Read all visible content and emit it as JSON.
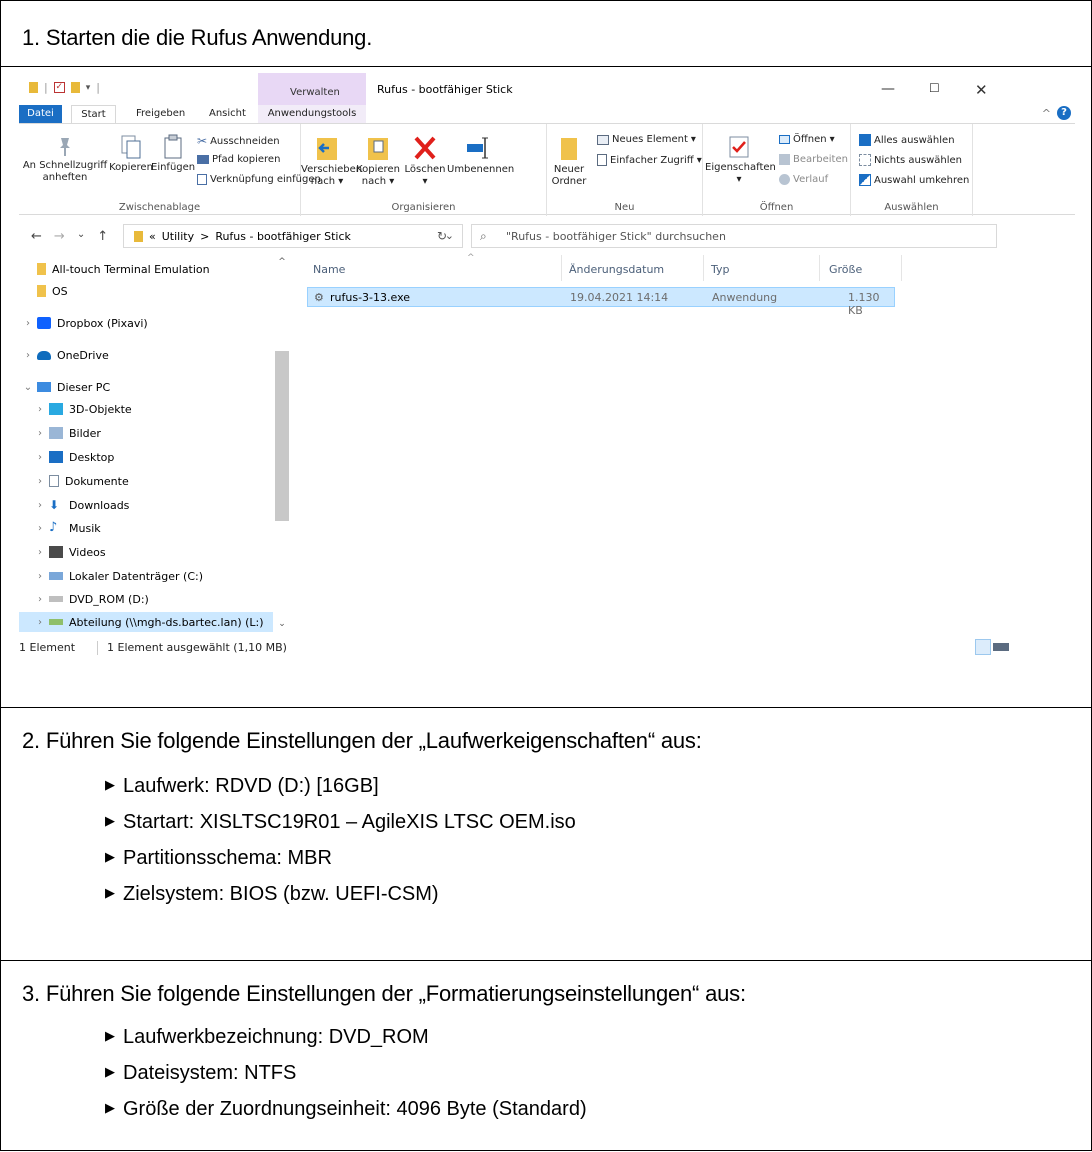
{
  "step1": {
    "title": "1. Starten die die Rufus Anwendung."
  },
  "explorer": {
    "window_title": "Rufus - bootfähiger Stick",
    "verwalten_tab": "Verwalten",
    "tabs": [
      "Datei",
      "Start",
      "Freigeben",
      "Ansicht",
      "Anwendungstools"
    ],
    "ribbon": {
      "zwischenablage": {
        "label": "Zwischenablage",
        "pin_line1": "An Schnellzugriff",
        "pin_line2": "anheften",
        "copy": "Kopieren",
        "paste": "Einfügen",
        "cut": "Ausschneiden",
        "copy_path": "Pfad kopieren",
        "paste_shortcut": "Verknüpfung einfügen"
      },
      "organisieren": {
        "label": "Organisieren",
        "move_line1": "Verschieben",
        "move_line2": "nach",
        "copyto_line1": "Kopieren",
        "copyto_line2": "nach",
        "delete": "Löschen",
        "rename": "Umbenennen"
      },
      "neu": {
        "label": "Neu",
        "new_folder_line1": "Neuer",
        "new_folder_line2": "Ordner",
        "new_item": "Neues Element",
        "easy_access": "Einfacher Zugriff"
      },
      "oeffnen": {
        "label": "Öffnen",
        "properties": "Eigenschaften",
        "open": "Öffnen",
        "edit": "Bearbeiten",
        "history": "Verlauf"
      },
      "auswaehlen": {
        "label": "Auswählen",
        "select_all": "Alles auswählen",
        "select_none": "Nichts auswählen",
        "invert": "Auswahl umkehren"
      }
    },
    "address": {
      "prefix": "«",
      "crumb1": "Utility",
      "sep": ">",
      "crumb2": "Rufus - bootfähiger Stick"
    },
    "search_placeholder": "\"Rufus - bootfähiger Stick\" durchsuchen",
    "nav_items": [
      "All-touch Terminal Emulation",
      "OS",
      "Dropbox (Pixavi)",
      "OneDrive",
      "Dieser PC",
      "3D-Objekte",
      "Bilder",
      "Desktop",
      "Dokumente",
      "Downloads",
      "Musik",
      "Videos",
      "Lokaler Datenträger (C:)",
      "DVD_ROM (D:)",
      "Abteilung (\\\\mgh-ds.bartec.lan) (L:)"
    ],
    "columns": [
      "Name",
      "Änderungsdatum",
      "Typ",
      "Größe"
    ],
    "files": [
      {
        "name": "rufus-3-13.exe",
        "date": "19.04.2021 14:14",
        "type": "Anwendung",
        "size": "1.130 KB"
      }
    ],
    "status": {
      "count": "1 Element",
      "selected": "1 Element ausgewählt (1,10 MB)"
    }
  },
  "step2": {
    "title": "2. Führen Sie folgende Einstellungen der „Laufwerkeigenschaften“ aus:",
    "bullets": [
      "Laufwerk: RDVD (D:) [16GB]",
      "Startart: XISLTSC19R01 – AgileXIS LTSC OEM.iso",
      "Partitionsschema: MBR",
      "Zielsystem: BIOS (bzw. UEFI-CSM)"
    ]
  },
  "step3": {
    "title": "3. Führen Sie folgende Einstellungen der „Formatierungseinstellungen“ aus:",
    "bullets": [
      "Laufwerkbezeichnung: DVD_ROM",
      "Dateisystem: NTFS",
      "Größe der Zuordnungseinheit: 4096 Byte (Standard)"
    ]
  },
  "colors": {
    "accent": "#1a6ec4",
    "selection": "#cce8ff",
    "folder": "#e8b93a",
    "verwalten": "#e8d8f5"
  }
}
